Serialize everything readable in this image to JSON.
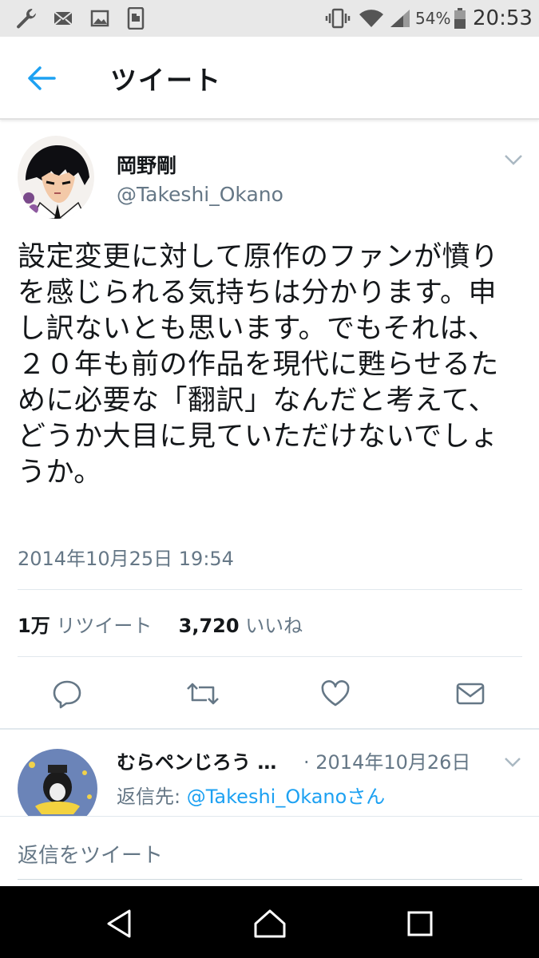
{
  "status_bar": {
    "battery": "54%",
    "time": "20:53",
    "left_icons": [
      "wrench-icon",
      "mail-icon",
      "image-icon",
      "phone-icon"
    ],
    "right_icons": [
      "vibrate-icon",
      "wifi-icon",
      "signal-icon",
      "battery-icon"
    ]
  },
  "app_bar": {
    "title": "ツイート",
    "back_icon": "arrow-left-icon"
  },
  "tweet": {
    "author_name": "岡野剛",
    "author_handle": "@Takeshi_Okano",
    "text": "設定変更に対して原作のファンが憤りを感じられる気持ちは分かります。申し訳ないとも思います。でもそれは、２０年も前の作品を現代に甦らせるために必要な「翻訳」なんだと考えて、どうか大目に見ていただけないでしょうか。",
    "timestamp": "2014年10月25日 19:54",
    "retweet_count": "1万",
    "retweet_label": "リツイート",
    "like_count": "3,720",
    "like_label": "いいね"
  },
  "actions": [
    "reply-icon",
    "retweet-icon",
    "like-icon",
    "message-icon"
  ],
  "reply_preview": {
    "name": "むらペンじろう …",
    "date": "· 2014年10月26日",
    "reply_to_label": "返信先:",
    "reply_to_link": "@Takeshi_Okanoさん"
  },
  "composer": {
    "placeholder": "返信をツイート"
  },
  "colors": {
    "accent": "#1da1f2",
    "secondary_text": "#657786",
    "primary_text": "#14171a",
    "status_bar_bg": "#e8e8e8",
    "nav_bar_bg": "#000000"
  }
}
